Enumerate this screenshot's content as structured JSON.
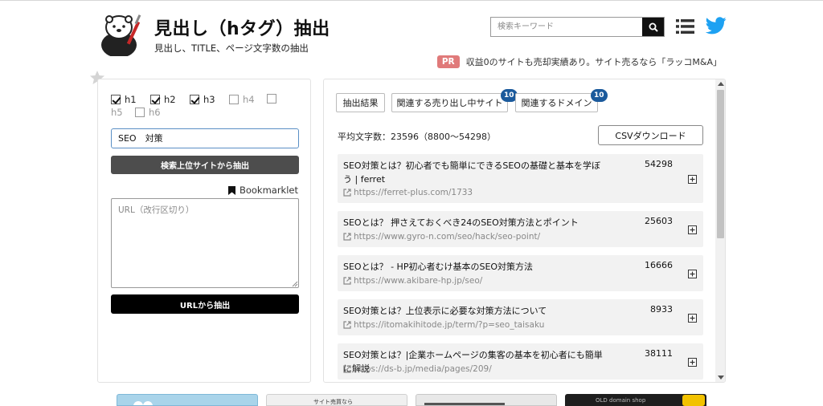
{
  "header": {
    "title": "見出し（hタグ）抽出",
    "subtitle": "見出し、TITLE、ページ文字数の抽出",
    "search_placeholder": "検索キーワード",
    "pr_badge": "PR",
    "pr_text": "収益0のサイトも売却実績あり。サイト売るなら「ラッコM&A」"
  },
  "options": {
    "checkboxes": [
      {
        "label": "h1",
        "checked": true
      },
      {
        "label": "h2",
        "checked": true
      },
      {
        "label": "h3",
        "checked": true
      },
      {
        "label": "h4",
        "checked": false
      },
      {
        "label": "h5",
        "checked": false
      },
      {
        "label": "h6",
        "checked": false
      }
    ],
    "keyword_value": "SEO　対策",
    "extract_top_label": "検索上位サイトから抽出",
    "bookmarklet_label": "Bookmarklet",
    "url_placeholder": "URL（改行区切り）",
    "url_extract_label": "URLから抽出"
  },
  "results_panel": {
    "tabs": [
      {
        "label": "抽出結果",
        "badge": ""
      },
      {
        "label": "関連する売り出し中サイト",
        "badge": "10"
      },
      {
        "label": "関連するドメイン",
        "badge": "10"
      }
    ],
    "average": "平均文字数：23596（8800〜54298）",
    "csv_label": "CSVダウンロード",
    "items": [
      {
        "title": "SEO対策とは？初心者でも簡単にできるSEOの基礎と基本を学ぼう | ferret",
        "count": "54298",
        "url": "https://ferret-plus.com/1733"
      },
      {
        "title": "SEOとは？ 押さえておくべき24のSEO対策方法とポイント",
        "count": "25603",
        "url": "https://www.gyro-n.com/seo/hack/seo-point/"
      },
      {
        "title": "SEOとは？ - HP初心者むけ基本のSEO対策方法",
        "count": "16666",
        "url": "https://www.akibare-hp.jp/seo/"
      },
      {
        "title": "SEO対策とは？上位表示に必要な対策方法について",
        "count": "8933",
        "url": "https://itomakihitode.jp/term/?p=seo_taisaku"
      },
      {
        "title": "SEO対策とは？|企業ホームページの集客の基本を初心者にも簡単に解説",
        "count": "38111",
        "url": "https://ds-b.jp/media/pages/209/"
      }
    ]
  },
  "banners": [
    {
      "text": ""
    },
    {
      "text": "サイト売買なら"
    },
    {
      "text": ""
    },
    {
      "text": "OLD domain shop"
    }
  ],
  "colors": {
    "pr_badge": "#e07a7a",
    "tab_badge": "#1b5a9c",
    "twitter": "#1da1f2",
    "primary_button": "#000000",
    "secondary_button": "#4d4d4d"
  }
}
